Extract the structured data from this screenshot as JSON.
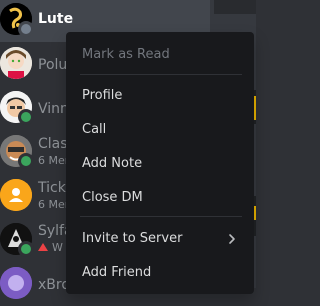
{
  "dm_list": {
    "items": [
      {
        "name": "Lute",
        "status": "idle-grey",
        "active": true
      },
      {
        "name": "Polu"
      },
      {
        "name": "Vinn",
        "status": "online"
      },
      {
        "name": "Clas",
        "sub": "6 Mem",
        "status": "online"
      },
      {
        "name": "Tick",
        "sub": "6 Mem"
      },
      {
        "name": "Sylfa",
        "sub": "W",
        "status": "online"
      },
      {
        "name": "xBro"
      }
    ]
  },
  "context_menu": {
    "mark_as_read": "Mark as Read",
    "profile": "Profile",
    "call": "Call",
    "add_note": "Add Note",
    "close_dm": "Close DM",
    "invite_to_server": "Invite to Server",
    "add_friend": "Add Friend"
  },
  "icons": {
    "submenu": "chevron-right-icon"
  },
  "colors": {
    "sidebar_bg": "#2f3136",
    "menu_bg": "#18191c",
    "online": "#3ba55d",
    "text_muted": "#8e9297",
    "text_normal": "#dcddde",
    "text_disabled": "#72767d"
  }
}
